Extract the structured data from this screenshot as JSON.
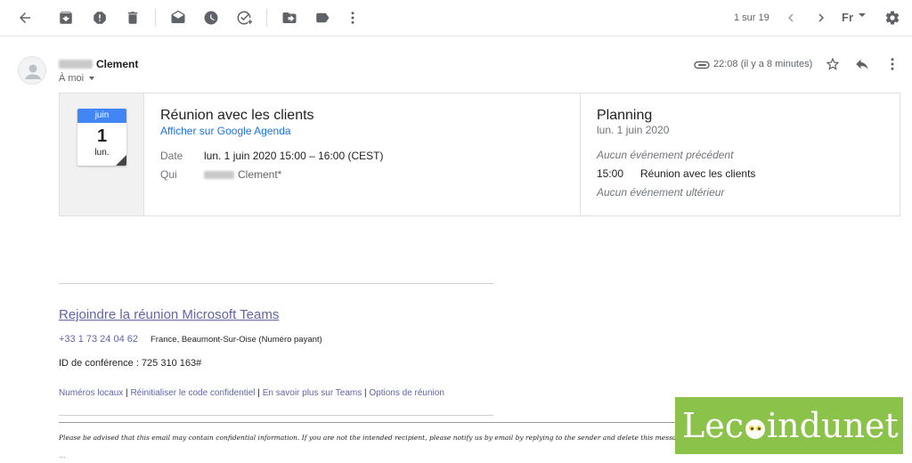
{
  "toolbar": {
    "pager": "1 sur 19",
    "lang": "Fr"
  },
  "header": {
    "sender_name": "Clement",
    "to_label": "À moi",
    "time": "22:08 (il y a 8 minutes)"
  },
  "invite": {
    "cal_month": "juin",
    "cal_day": "1",
    "cal_weekday": "lun.",
    "title": "Réunion avec les clients",
    "calendar_link": "Afficher sur Google Agenda",
    "date_label": "Date",
    "date_value": "lun. 1 juin 2020 15:00 – 16:00 (CEST)",
    "who_label": "Qui",
    "who_value": "Clement*"
  },
  "planning": {
    "title": "Planning",
    "date": "lun. 1 juin 2020",
    "prev": "Aucun événement précédent",
    "time": "15:00",
    "event": "Réunion avec les clients",
    "next": "Aucun événement ultérieur"
  },
  "teams": {
    "join": "Rejoindre la réunion Microsoft Teams",
    "phone": "+33 1 73 24 04 62",
    "location": "France, Beaumont-Sur-Oise (Numéro payant)",
    "conf_id": "ID de conférence : 725 310 163#",
    "links": {
      "local": "Numéros locaux",
      "reset": "Réinitialiser le code confidentiel",
      "learn": "En savoir plus sur Teams",
      "options": "Options de réunion"
    },
    "disclaimer": "Please be advised that this email may contain confidential information. If you are not the intended recipient, please notify us by email by replying to the sender and delete this message.",
    "ellipsis": "..."
  },
  "watermark": {
    "text_before": "Lec",
    "text_after": "indunet"
  },
  "colors": {
    "teams": "#6264a7",
    "calendar_blue": "#4285f4",
    "link_blue": "#1a73e8",
    "watermark_green": "#8bc34a"
  }
}
